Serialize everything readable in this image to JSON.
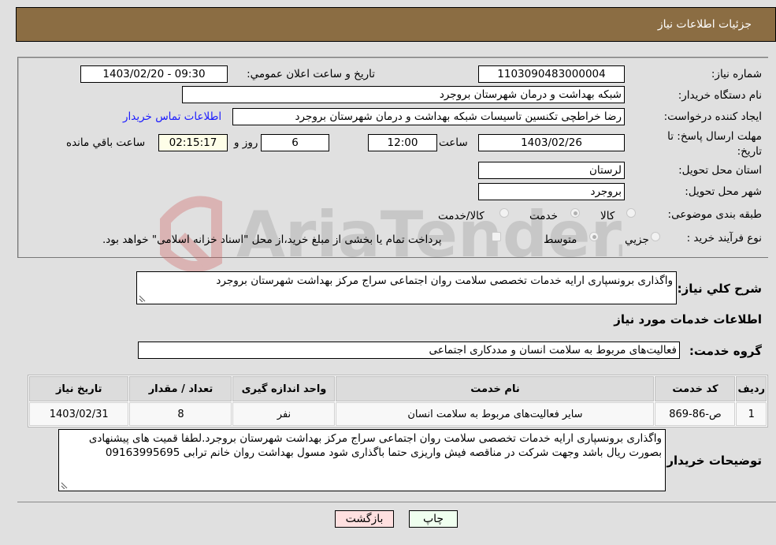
{
  "header": {
    "title": "جزئیات اطلاعات نیاز"
  },
  "form": {
    "need_number": {
      "label": "شماره نیاز:",
      "value": "1103090483000004"
    },
    "announce_datetime": {
      "label": "تاریخ و ساعت اعلان عمومي:",
      "value": "1403/02/20 - 09:30"
    },
    "buyer_org": {
      "label": "نام دستگاه خریدار:",
      "value": "شبکه بهداشت و درمان شهرستان بروجرد"
    },
    "creator": {
      "label": "ایجاد کننده درخواست:",
      "value": "رضا خراطچی تکنسین تاسیسات شبکه بهداشت و درمان شهرستان بروجرد"
    },
    "buyer_contact_link": "اطلاعات تماس خریدار",
    "deadline": {
      "label": "مهلت ارسال پاسخ: تا تاریخ:",
      "date": "1403/02/26",
      "time_label": "ساعت",
      "time": "12:00",
      "days": "6",
      "days_label": "روز و",
      "remaining": "02:15:17",
      "remaining_label": "ساعت باقي مانده"
    },
    "province": {
      "label": "استان محل تحویل:",
      "value": "لرستان"
    },
    "city": {
      "label": "شهر محل تحویل:",
      "value": "بروجرد"
    },
    "category": {
      "label": "طبقه بندی موضوعی:",
      "options": [
        "کالا",
        "خدمت",
        "کالا/خدمت"
      ],
      "selected": "خدمت"
    },
    "purchase_process": {
      "label": "نوع فرآیند خرید :",
      "options": [
        "جزيي",
        "متوسط"
      ],
      "selected": "متوسط",
      "treasury_checkbox_label": "پرداخت تمام یا بخشی از مبلغ خرید،از محل \"اسناد خزانه اسلامی\" خواهد بود.",
      "treasury_checked": false
    }
  },
  "description": {
    "label": "شرح کلي نیاز:",
    "value": "واگذاری برونسپاری ارایه خدمات تخصصی سلامت روان اجتماعی سراج مرکز بهداشت شهرستان بروجرد"
  },
  "services_section": {
    "title": "اطلاعات خدمات مورد نیاز",
    "group_label": "گروه خدمت:",
    "group_value": "فعالیت‌های مربوط به سلامت انسان و مددکاری اجتماعی",
    "table": {
      "headers": [
        "ردیف",
        "کد خدمت",
        "نام خدمت",
        "واحد اندازه گیری",
        "تعداد / مقدار",
        "تاریخ نیاز"
      ],
      "rows": [
        [
          "1",
          "ص-86-869",
          "سایر فعالیت‌های مربوط به سلامت انسان",
          "نفر",
          "8",
          "1403/02/31"
        ]
      ]
    }
  },
  "buyer_notes": {
    "label": "توضیحات خریدار:",
    "value": "واگذاری برونسپاری ارایه خدمات تخصصی سلامت روان اجتماعی سراج مرکز بهداشت شهرستان بروجرد.لطفا قمیت های پیشنهادی بصورت ریال باشد وجهت شرکت در مناقصه فیش واریزی حتما باگذاری شود مسول بهداشت روان خانم ترابی 09163995695"
  },
  "buttons": {
    "print": "چاپ",
    "back": "بازگشت"
  },
  "colors": {
    "header_bg": "#8b6d43",
    "print_bg": "#efffef",
    "back_bg": "#ffe0e0",
    "link": "#1a1aff"
  },
  "watermark": {
    "text": "AriaTender.neT"
  }
}
